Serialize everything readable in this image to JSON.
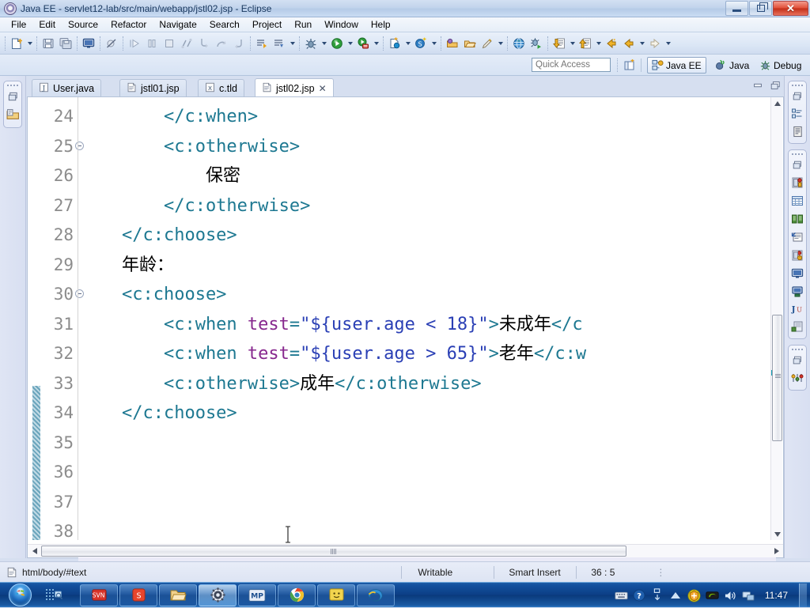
{
  "window": {
    "title": "Java EE - servlet12-lab/src/main/webapp/jstl02.jsp - Eclipse",
    "app_icon": "eclipse-icon",
    "minimize_label": "Minimize",
    "restore_label": "Restore",
    "close_label": "Close"
  },
  "menu": {
    "items": [
      {
        "label": "File"
      },
      {
        "label": "Edit"
      },
      {
        "label": "Source"
      },
      {
        "label": "Refactor"
      },
      {
        "label": "Navigate"
      },
      {
        "label": "Search"
      },
      {
        "label": "Project"
      },
      {
        "label": "Run"
      },
      {
        "label": "Window"
      },
      {
        "label": "Help"
      }
    ]
  },
  "toolbar": {
    "items": [
      {
        "name": "new-wizard-icon",
        "tooltip": "New"
      },
      {
        "name": "new-wizard-dropdown-icon",
        "tooltip": "New menu"
      },
      {
        "name": "save-icon",
        "tooltip": "Save"
      },
      {
        "name": "save-all-icon",
        "tooltip": "Save All"
      },
      {
        "name": "console-icon",
        "tooltip": "Open Console"
      },
      {
        "name": "toggle-breakpoint-icon",
        "tooltip": "Skip All Breakpoints"
      },
      {
        "name": "resume-icon",
        "tooltip": "Resume"
      },
      {
        "name": "suspend-icon",
        "tooltip": "Suspend"
      },
      {
        "name": "terminate-icon",
        "tooltip": "Terminate"
      },
      {
        "name": "disconnect-icon",
        "tooltip": "Disconnect"
      },
      {
        "name": "step-into-icon",
        "tooltip": "Step Into"
      },
      {
        "name": "step-over-icon",
        "tooltip": "Step Over"
      },
      {
        "name": "step-return-icon",
        "tooltip": "Step Return"
      },
      {
        "name": "run-last-tool-icon",
        "tooltip": "Run Last Tool"
      },
      {
        "name": "external-tools-icon",
        "tooltip": "External Tools"
      },
      {
        "name": "debug-icon",
        "tooltip": "Debug"
      },
      {
        "name": "debug-dropdown-icon",
        "tooltip": "Debug menu"
      },
      {
        "name": "run-icon",
        "tooltip": "Run"
      },
      {
        "name": "run-dropdown-icon",
        "tooltip": "Run menu"
      },
      {
        "name": "run-on-server-icon",
        "tooltip": "Run on Server"
      },
      {
        "name": "run-on-server-dropdown-icon",
        "tooltip": "Run on Server menu"
      },
      {
        "name": "new-java-class-icon",
        "tooltip": "New Java Class"
      },
      {
        "name": "new-java-class-dropdown-icon",
        "tooltip": "New Java Class menu"
      },
      {
        "name": "new-servlet-icon",
        "tooltip": "New Servlet"
      },
      {
        "name": "new-servlet-dropdown-icon",
        "tooltip": "New Servlet menu"
      },
      {
        "name": "open-type-icon",
        "tooltip": "Open Type"
      },
      {
        "name": "open-task-icon",
        "tooltip": "Open Task"
      },
      {
        "name": "edit-icon",
        "tooltip": "Edit"
      },
      {
        "name": "edit-dropdown-icon",
        "tooltip": "Edit menu"
      },
      {
        "name": "open-web-browser-icon",
        "tooltip": "Open Web Browser"
      },
      {
        "name": "debug-web-icon",
        "tooltip": "Debug on Server"
      },
      {
        "name": "next-annotation-icon",
        "tooltip": "Next Annotation"
      },
      {
        "name": "next-annotation-dropdown-icon",
        "tooltip": "Next Annotation menu"
      },
      {
        "name": "previous-annotation-icon",
        "tooltip": "Previous Annotation"
      },
      {
        "name": "previous-annotation-dropdown-icon",
        "tooltip": "Previous Annotation menu"
      },
      {
        "name": "back-icon",
        "tooltip": "Back"
      },
      {
        "name": "back-dropdown-icon",
        "tooltip": "Back menu"
      },
      {
        "name": "forward-icon",
        "tooltip": "Forward"
      },
      {
        "name": "forward-dropdown-icon",
        "tooltip": "Forward menu"
      }
    ]
  },
  "quick_access": {
    "placeholder": "Quick Access",
    "value": ""
  },
  "perspectives": {
    "open_perspective_icon": "open-perspective-icon",
    "items": [
      {
        "label": "Java EE",
        "icon": "java-ee-perspective-icon",
        "active": true
      },
      {
        "label": "Java",
        "icon": "java-perspective-icon",
        "active": false
      },
      {
        "label": "Debug",
        "icon": "debug-perspective-icon",
        "active": false
      }
    ]
  },
  "left_fast_view": {
    "restore_icon": "restore-view-icon",
    "items": [
      {
        "name": "project-explorer-icon",
        "label": "Project Explorer"
      }
    ]
  },
  "right_fast_view": {
    "groups": [
      {
        "restore_icon": "restore-view-icon",
        "items": [
          {
            "name": "outline-view-icon",
            "label": "Outline"
          },
          {
            "name": "task-list-view-icon",
            "label": "Task List"
          }
        ]
      },
      {
        "restore_icon": "restore-view-icon",
        "items": [
          {
            "name": "servers-view-icon",
            "label": "Servers"
          },
          {
            "name": "data-source-explorer-icon",
            "label": "Data Source Explorer"
          },
          {
            "name": "snippets-view-icon",
            "label": "Snippets"
          },
          {
            "name": "properties-view-icon",
            "label": "Properties"
          },
          {
            "name": "problems-view-icon",
            "label": "Problems"
          },
          {
            "name": "console-view-icon",
            "label": "Console"
          },
          {
            "name": "terminal-view-icon",
            "label": "Terminal"
          },
          {
            "name": "junit-view-icon",
            "label": "JUnit"
          },
          {
            "name": "servers-alt-view-icon",
            "label": "Servers"
          }
        ]
      },
      {
        "restore_icon": "restore-view-icon",
        "items": [
          {
            "name": "history-view-icon",
            "label": "History"
          }
        ]
      }
    ]
  },
  "editor": {
    "tabs": [
      {
        "label": "User.java",
        "icon": "java-file-icon",
        "active": false,
        "closable": false
      },
      {
        "label": "jstl01.jsp",
        "icon": "jsp-file-icon",
        "active": false,
        "closable": false
      },
      {
        "label": "c.tld",
        "icon": "xml-file-icon",
        "active": false,
        "closable": false
      },
      {
        "label": "jstl02.jsp",
        "icon": "jsp-file-icon",
        "active": true,
        "closable": true
      }
    ],
    "close_glyph": "✕",
    "minimize_label": "Minimize",
    "maximize_label": "Maximize",
    "first_line": 24,
    "current_line": 36,
    "lines": [
      {
        "num": 24,
        "fold": false,
        "tokens": [
          {
            "t": "tag",
            "s": "        </c:when>"
          }
        ]
      },
      {
        "num": 25,
        "fold": true,
        "tokens": [
          {
            "t": "tag",
            "s": "        <c:otherwise>"
          }
        ]
      },
      {
        "num": 26,
        "fold": false,
        "tokens": [
          {
            "t": "txt",
            "s": "            保密"
          }
        ]
      },
      {
        "num": 27,
        "fold": false,
        "tokens": [
          {
            "t": "tag",
            "s": "        </c:otherwise>"
          }
        ]
      },
      {
        "num": 28,
        "fold": false,
        "tokens": [
          {
            "t": "tag",
            "s": "    </c:choose>"
          }
        ]
      },
      {
        "num": 29,
        "fold": false,
        "tokens": [
          {
            "t": "txt",
            "s": "    年龄："
          }
        ]
      },
      {
        "num": 30,
        "fold": true,
        "tokens": [
          {
            "t": "tag",
            "s": "    <c:choose>"
          }
        ]
      },
      {
        "num": 31,
        "fold": false,
        "tokens": [
          {
            "t": "tag",
            "s": "        <c:when "
          },
          {
            "t": "attr",
            "s": "test"
          },
          {
            "t": "tag",
            "s": "="
          },
          {
            "t": "val",
            "s": "\"${user.age < 18}\""
          },
          {
            "t": "tag",
            "s": ">"
          },
          {
            "t": "txt",
            "s": "未成年"
          },
          {
            "t": "tag",
            "s": "</c"
          }
        ]
      },
      {
        "num": 32,
        "fold": false,
        "tokens": [
          {
            "t": "tag",
            "s": "        <c:when "
          },
          {
            "t": "attr",
            "s": "test"
          },
          {
            "t": "tag",
            "s": "="
          },
          {
            "t": "val",
            "s": "\"${user.age > 65}\""
          },
          {
            "t": "tag",
            "s": ">"
          },
          {
            "t": "txt",
            "s": "老年"
          },
          {
            "t": "tag",
            "s": "</c:w"
          }
        ]
      },
      {
        "num": 33,
        "fold": false,
        "tokens": [
          {
            "t": "tag",
            "s": "        <c:otherwise>"
          },
          {
            "t": "txt",
            "s": "成年"
          },
          {
            "t": "tag",
            "s": "</c:otherwise>"
          }
        ]
      },
      {
        "num": 34,
        "fold": false,
        "tokens": [
          {
            "t": "tag",
            "s": "    </c:choose>"
          }
        ]
      },
      {
        "num": 35,
        "fold": false,
        "tokens": []
      },
      {
        "num": 36,
        "fold": false,
        "tokens": []
      },
      {
        "num": 37,
        "fold": false,
        "tokens": []
      },
      {
        "num": 38,
        "fold": false,
        "tokens": []
      }
    ]
  },
  "status_bar": {
    "doc_icon": "document-icon",
    "breadcrumb": "html/body/#text",
    "writable": "Writable",
    "insert_mode": "Smart Insert",
    "position": "36 : 5"
  },
  "taskbar": {
    "start_label": "Start",
    "quick_launch_icon": "show-desktop-peek-icon",
    "items": [
      {
        "name": "taskbar-item-svn",
        "label": "SVN"
      },
      {
        "name": "taskbar-item-sogou",
        "label": "Sogou"
      },
      {
        "name": "taskbar-item-explorer",
        "label": "Windows Explorer"
      },
      {
        "name": "taskbar-item-settings",
        "label": "Settings"
      },
      {
        "name": "taskbar-item-mp",
        "label": "MP"
      },
      {
        "name": "taskbar-item-chrome",
        "label": "Google Chrome"
      },
      {
        "name": "taskbar-item-notepad",
        "label": "Notes"
      },
      {
        "name": "taskbar-item-ie",
        "label": "Internet Explorer"
      }
    ],
    "tray": [
      {
        "name": "ime-keyboard-icon",
        "label": "Input Method"
      },
      {
        "name": "help-icon",
        "label": "Help"
      },
      {
        "name": "ime-switch-icon",
        "label": "Switch Input"
      },
      {
        "name": "show-hidden-icons-icon",
        "label": "Show hidden icons"
      },
      {
        "name": "security-shield-icon",
        "label": "Security"
      },
      {
        "name": "nvidia-icon",
        "label": "NVIDIA Settings"
      },
      {
        "name": "volume-icon",
        "label": "Volume"
      },
      {
        "name": "network-icon",
        "label": "Network"
      }
    ],
    "clock": "11:47"
  },
  "colors": {
    "tag": "#1d7891",
    "attribute": "#87288e",
    "value": "#2a3fb5",
    "text": "#000000",
    "line_number": "#8c8c8c",
    "current_line_highlight": "#eaeaf7",
    "title_text": "#17365d",
    "taskbar": "#0c3f86"
  }
}
